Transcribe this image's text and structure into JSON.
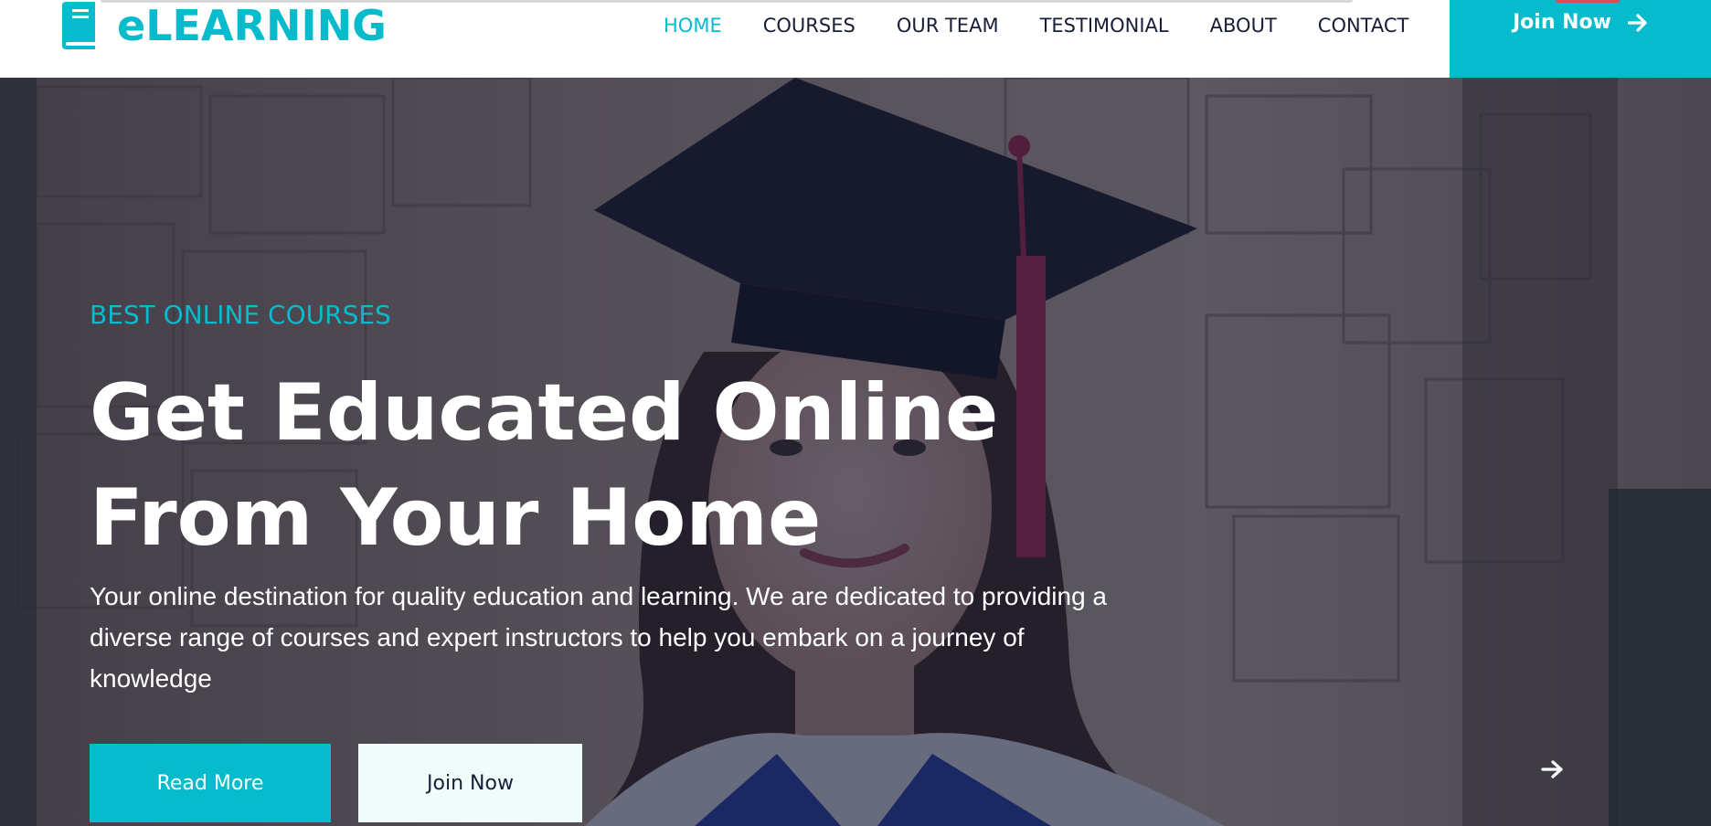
{
  "colors": {
    "accent": "#06bbcc",
    "dark": "#181d38",
    "light_button": "#f0fbfc"
  },
  "brand": {
    "name": "eLEARNING",
    "icon": "book-icon"
  },
  "nav": {
    "items": [
      {
        "label": "HOME",
        "active": true
      },
      {
        "label": "COURSES",
        "active": false
      },
      {
        "label": "OUR TEAM",
        "active": false
      },
      {
        "label": "TESTIMONIAL",
        "active": false
      },
      {
        "label": "ABOUT",
        "active": false
      },
      {
        "label": "CONTACT",
        "active": false
      }
    ],
    "cta_label": "Join Now",
    "cta_icon": "arrow-right-icon"
  },
  "hero": {
    "subtitle": "BEST ONLINE COURSES",
    "title_line1": "Get Educated Online",
    "title_line2": "From Your Home",
    "description": "Your online destination for quality education and learning. We are dedicated to providing a diverse range of courses and expert instructors to help you embark on a journey of knowledge",
    "primary_button": "Read More",
    "secondary_button": "Join Now",
    "carousel_next_icon": "arrow-right-icon"
  }
}
